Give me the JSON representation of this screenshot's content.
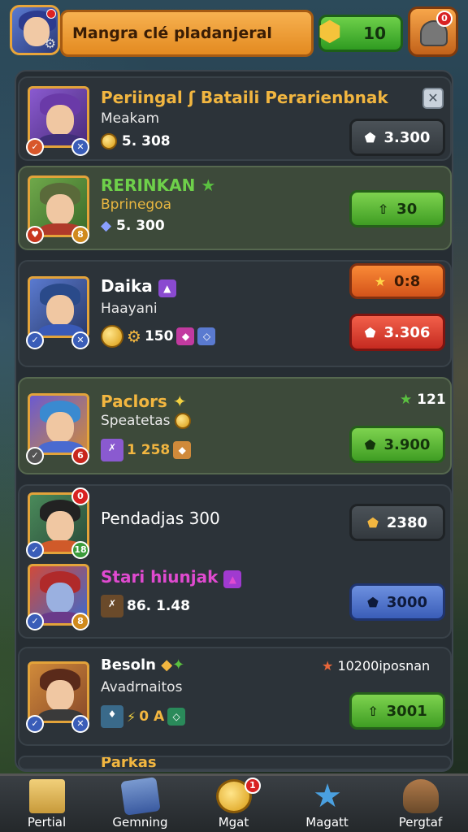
{
  "header": {
    "title": "Mangra clé pladanjeral",
    "currency_value": "10",
    "helmet_badge": "0"
  },
  "close_label": "✕",
  "cards": [
    {
      "name": "Periingal ʃ Bataili Perarienbnak",
      "subtitle": "Meakam",
      "value": "5. 308",
      "button": "3.300",
      "badges": [
        "✓",
        "✕"
      ]
    },
    {
      "name": "RERINKAN",
      "subtitle": "Bprinegoa",
      "value": "5. 300",
      "button": "30",
      "badges": [
        "♥",
        "8"
      ]
    },
    {
      "name": "Daika",
      "subtitle": "Haayani",
      "value": "150",
      "button_top": "0:8",
      "button": "3.306",
      "badges": [
        "✓",
        "✕"
      ]
    },
    {
      "name": "Paclors",
      "subtitle": "Speatetas",
      "value": "1 258",
      "button": "3.900",
      "corner": "121",
      "badges": [
        "✓",
        "6"
      ]
    },
    {
      "name": "Pendadjas 300",
      "subtitle": "",
      "value": "",
      "button": "2380",
      "badge_top": "0",
      "badges": [
        "✓",
        "18"
      ]
    },
    {
      "name": "Stari hiunjak",
      "subtitle": "",
      "value": "86. 1.48",
      "button": "3000",
      "badges": [
        "✓",
        "8"
      ]
    },
    {
      "name": "Besoln",
      "subtitle": "Avadrnaitos",
      "value": "0 A",
      "button": "3001",
      "corner": "10200iposnan",
      "badges": [
        "✓",
        "✕"
      ]
    },
    {
      "name": "Parkas",
      "subtitle": "",
      "value": "",
      "button": "",
      "badges": []
    }
  ],
  "tabs": [
    {
      "label": "Pertial"
    },
    {
      "label": "Gemning"
    },
    {
      "label": "Mgat",
      "badge": "1"
    },
    {
      "label": "Magatt"
    },
    {
      "label": "Pergtaf"
    }
  ]
}
